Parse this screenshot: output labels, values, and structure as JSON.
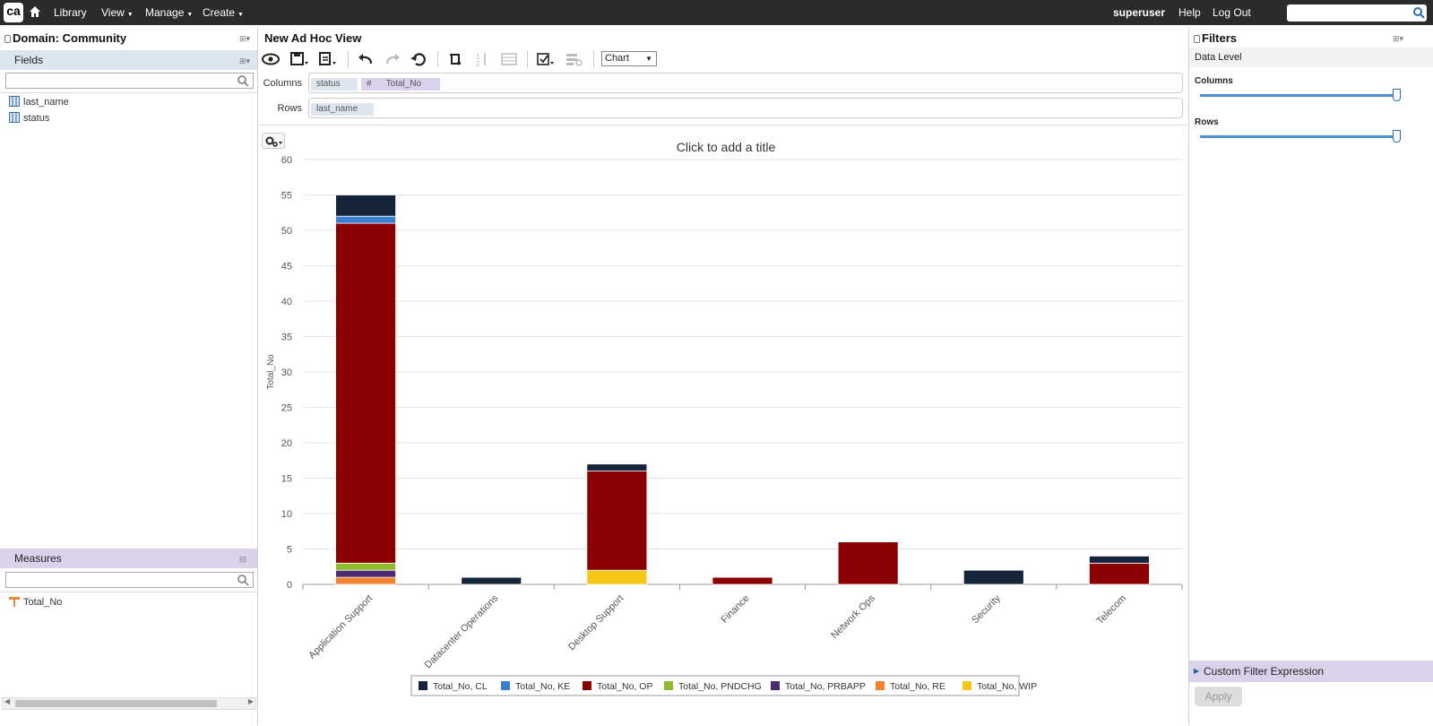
{
  "topbar": {
    "logo": "ca",
    "nav": [
      "Library",
      "View",
      "Manage",
      "Create"
    ],
    "user": "superuser",
    "help": "Help",
    "logout": "Log Out",
    "search_value": ""
  },
  "left": {
    "title": "Domain: Community",
    "fields_label": "Fields",
    "fields_filter": "",
    "fields": [
      "last_name",
      "status"
    ],
    "measures_label": "Measures",
    "measures_filter": "",
    "measures": [
      "Total_No"
    ]
  },
  "center": {
    "title": "New Ad Hoc View",
    "view_type": "Chart",
    "columns_label": "Columns",
    "rows_label": "Rows",
    "columns": [
      "status",
      "Total_No"
    ],
    "measure_marker": "#",
    "rows": [
      "last_name"
    ],
    "chart_title_hint": "Click to add a title"
  },
  "right": {
    "title": "Filters",
    "data_level": "Data Level",
    "columns_label": "Columns",
    "rows_label": "Rows",
    "columns_level": 1,
    "rows_level": 1,
    "custom_filter": "Custom Filter Expression",
    "apply": "Apply"
  },
  "colors": {
    "CL": "#14243b",
    "KE": "#3a7fd0",
    "OP": "#8b0000",
    "PNDCHG": "#8dbb2c",
    "PRBAPP": "#4b2c71",
    "RE": "#f08232",
    "WIP": "#f7c717"
  },
  "chart_data": {
    "type": "bar",
    "stacked": true,
    "title": "",
    "xlabel": "",
    "ylabel": "Total_No",
    "ylim": [
      0,
      60
    ],
    "yticks": [
      0,
      5,
      10,
      15,
      20,
      25,
      30,
      35,
      40,
      45,
      50,
      55,
      60
    ],
    "grid": true,
    "legend_position": "bottom",
    "categories": [
      "Application Support",
      "Datacenter Operations",
      "Desktop Support",
      "Finance",
      "Network Ops",
      "Security",
      "Telecom"
    ],
    "series": [
      {
        "name": "Total_No, RE",
        "key": "RE",
        "values": [
          1,
          0,
          0,
          0,
          0,
          0,
          0
        ]
      },
      {
        "name": "Total_No, PRBAPP",
        "key": "PRBAPP",
        "values": [
          1,
          0,
          0,
          0,
          0,
          0,
          0
        ]
      },
      {
        "name": "Total_No, PNDCHG",
        "key": "PNDCHG",
        "values": [
          1,
          0,
          0,
          0,
          0,
          0,
          0
        ]
      },
      {
        "name": "Total_No, WIP",
        "key": "WIP",
        "values": [
          0,
          0,
          2,
          0,
          0,
          0,
          0
        ]
      },
      {
        "name": "Total_No, OP",
        "key": "OP",
        "values": [
          48,
          0,
          14,
          1,
          6,
          0,
          3
        ]
      },
      {
        "name": "Total_No, KE",
        "key": "KE",
        "values": [
          1,
          0,
          0,
          0,
          0,
          0,
          0
        ]
      },
      {
        "name": "Total_No, CL",
        "key": "CL",
        "values": [
          3,
          1,
          1,
          0,
          0,
          2,
          1
        ]
      }
    ],
    "legend": [
      {
        "name": "Total_No, CL",
        "key": "CL"
      },
      {
        "name": "Total_No, KE",
        "key": "KE"
      },
      {
        "name": "Total_No, OP",
        "key": "OP"
      },
      {
        "name": "Total_No, PNDCHG",
        "key": "PNDCHG"
      },
      {
        "name": "Total_No, PRBAPP",
        "key": "PRBAPP"
      },
      {
        "name": "Total_No, RE",
        "key": "RE"
      },
      {
        "name": "Total_No, WIP",
        "key": "WIP"
      }
    ]
  }
}
